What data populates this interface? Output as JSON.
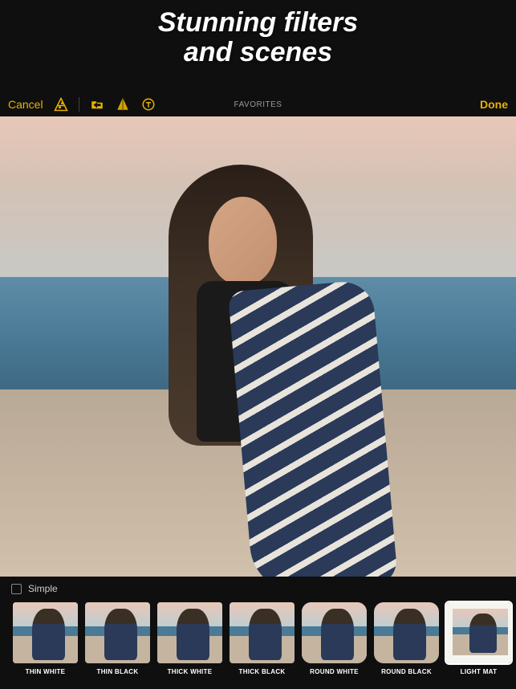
{
  "hero": {
    "line1": "Stunning filters",
    "line2": "and  scenes"
  },
  "toolbar": {
    "cancel_label": "Cancel",
    "center_label": "FAVORITES",
    "done_label": "Done",
    "icons": {
      "pizza": "pizza-icon",
      "folder": "folder-icon",
      "flip": "flip-horizontal-icon",
      "text": "text-circle-icon"
    }
  },
  "options": {
    "simple_label": "Simple",
    "simple_checked": false
  },
  "filters": [
    {
      "label": "THIN WHITE",
      "frame": "thin-white",
      "selected": false
    },
    {
      "label": "THIN BLACK",
      "frame": "thin-black",
      "selected": false
    },
    {
      "label": "THICK WHITE",
      "frame": "thick-white",
      "selected": false
    },
    {
      "label": "THICK BLACK",
      "frame": "thick-black",
      "selected": false
    },
    {
      "label": "ROUND WHITE",
      "frame": "round-white",
      "selected": false
    },
    {
      "label": "ROUND BLACK",
      "frame": "round-black",
      "selected": false
    },
    {
      "label": "LIGHT MAT",
      "frame": "light-mat",
      "selected": true
    }
  ],
  "colors": {
    "accent": "#e8b200",
    "bg": "#0f0f0f"
  }
}
